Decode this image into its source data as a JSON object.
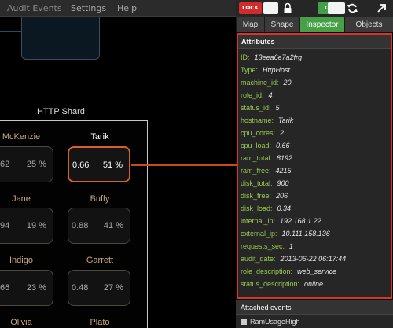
{
  "menu": {
    "audit_events": "Audit Events",
    "settings": "Settings",
    "help": "Help"
  },
  "toolbar": {
    "lock_label": "LOCK",
    "on_label": "ON",
    "lock_color": "#d22b2b",
    "on_color": "#43a047"
  },
  "tabs": [
    {
      "label": "Map"
    },
    {
      "label": "Shape"
    },
    {
      "label": "Inspector"
    },
    {
      "label": "Objects"
    }
  ],
  "canvas": {
    "shard_title": "HTTP Shard",
    "hosts": [
      {
        "name": "McKenzie",
        "load": "62",
        "pct": "25 %"
      },
      {
        "name": "Tarik",
        "load": "0.66",
        "pct": "51 %"
      },
      {
        "name": "Jane",
        "load": "94",
        "pct": "19 %"
      },
      {
        "name": "Buffy",
        "load": "0.88",
        "pct": "41 %"
      },
      {
        "name": "Indigo",
        "load": "66",
        "pct": "23 %"
      },
      {
        "name": "Garrett",
        "load": "0.48",
        "pct": "27 %"
      },
      {
        "name": "Olivia"
      },
      {
        "name": "Plato"
      }
    ]
  },
  "inspector": {
    "header": "Attributes",
    "attributes": [
      {
        "key": "ID:",
        "value": "13eea6e7a2frg"
      },
      {
        "key": "Type:",
        "value": "HttpHost"
      },
      {
        "key": "machine_id:",
        "value": "20"
      },
      {
        "key": "role_id:",
        "value": "4"
      },
      {
        "key": "status_id:",
        "value": "5"
      },
      {
        "key": "hostname:",
        "value": "Tarik"
      },
      {
        "key": "cpu_cores:",
        "value": "2"
      },
      {
        "key": "cpu_load:",
        "value": "0.66"
      },
      {
        "key": "ram_total:",
        "value": "8192"
      },
      {
        "key": "ram_free:",
        "value": "4215"
      },
      {
        "key": "disk_total:",
        "value": "900"
      },
      {
        "key": "disk_free:",
        "value": "206"
      },
      {
        "key": "disk_load:",
        "value": "0.34"
      },
      {
        "key": "internal_ip:",
        "value": "192.168.1.22"
      },
      {
        "key": "external_ip:",
        "value": "10.111.158.136"
      },
      {
        "key": "requests_sec:",
        "value": "1"
      },
      {
        "key": "audit_date:",
        "value": "2013-06-22 06:17:44"
      },
      {
        "key": "role_description:",
        "value": "web_service"
      },
      {
        "key": "status_description:",
        "value": "online"
      }
    ]
  },
  "events": {
    "header": "Attached events",
    "items": [
      {
        "label": "RamUsageHigh"
      }
    ]
  },
  "colors": {
    "highlight": "#d8602c",
    "attr_key": "#9aca4e",
    "inspector_border": "#dd3322"
  }
}
